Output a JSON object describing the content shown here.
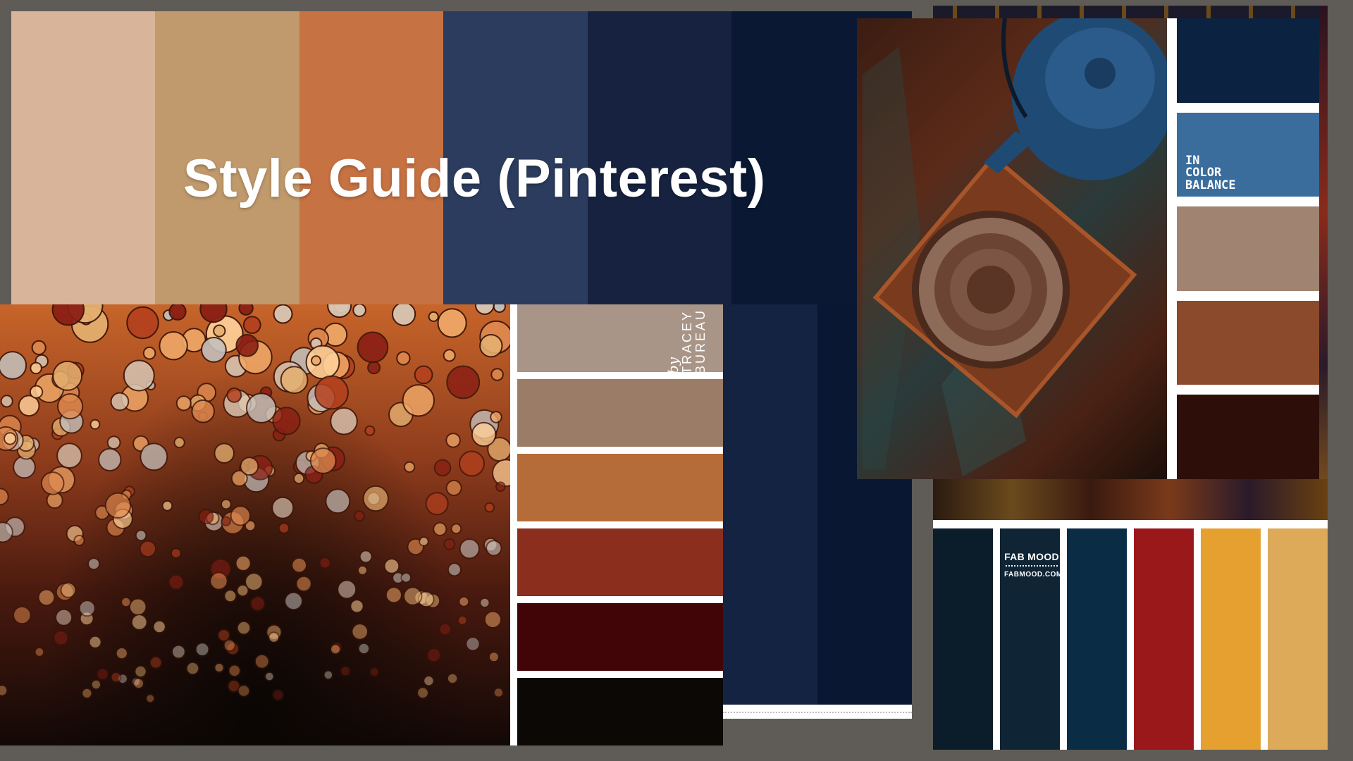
{
  "title": "Style Guide (Pinterest)",
  "top_palette": [
    "#d8b49a",
    "#c09a6c",
    "#c67242",
    "#2c3c5e",
    "#16223f",
    "#0a1834"
  ],
  "top_palette_lower": [
    "#142342",
    "#0a1733"
  ],
  "fluid_art": {
    "credit_by": "by",
    "credit_name": "TRACEY BUREAU",
    "palette": [
      "#a99588",
      "#9b7c66",
      "#b56c38",
      "#8c2e1e",
      "#410508",
      "#0c0806"
    ]
  },
  "teapot": {
    "label": "IN COLOR BALANCE",
    "label_lines": [
      "IN",
      "COLOR",
      "BALANCE"
    ],
    "palette": [
      "#0b2340",
      "#3a6c9c",
      "#a08471",
      "#8b4a2c",
      "#2e0e08"
    ]
  },
  "fabmood": {
    "logo": "FAB MOOD",
    "site": "FABMOOD.COM",
    "palette": [
      "#0b1c2a",
      "#0f2535",
      "#0b2c45",
      "#9a171a",
      "#e5a030",
      "#dcaa58"
    ]
  }
}
